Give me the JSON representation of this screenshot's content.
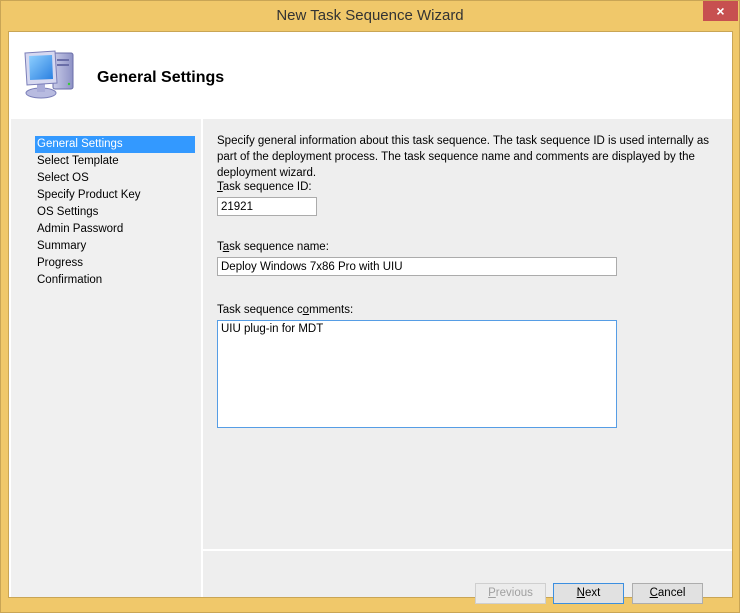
{
  "window": {
    "title": "New Task Sequence Wizard",
    "close_label": "×"
  },
  "header": {
    "icon": "computer-icon",
    "title": "General Settings"
  },
  "nav": {
    "items": [
      {
        "label": "General Settings",
        "active": true
      },
      {
        "label": "Select Template",
        "active": false
      },
      {
        "label": "Select OS",
        "active": false
      },
      {
        "label": "Specify Product Key",
        "active": false
      },
      {
        "label": "OS Settings",
        "active": false
      },
      {
        "label": "Admin Password",
        "active": false
      },
      {
        "label": "Summary",
        "active": false
      },
      {
        "label": "Progress",
        "active": false
      },
      {
        "label": "Confirmation",
        "active": false
      }
    ]
  },
  "content": {
    "description": "Specify general information about this task sequence.  The task sequence ID is used internally as part of the deployment process.  The task sequence name and comments are displayed by the deployment wizard.",
    "id_field": {
      "label_access": "T",
      "label_rest": "ask sequence ID:",
      "value": "21921"
    },
    "name_field": {
      "label_pre": "T",
      "label_access": "a",
      "label_rest": "sk sequence name:",
      "value": "Deploy Windows 7x86 Pro with UIU"
    },
    "comments_field": {
      "label_pre": "Task sequence c",
      "label_access": "o",
      "label_rest": "mments:",
      "value": "UIU plug-in for MDT"
    }
  },
  "footer": {
    "previous": {
      "access": "P",
      "rest": "revious",
      "enabled": false
    },
    "next": {
      "access": "N",
      "rest": "ext",
      "enabled": true
    },
    "cancel": {
      "access": "C",
      "rest": "ancel",
      "enabled": true
    }
  }
}
